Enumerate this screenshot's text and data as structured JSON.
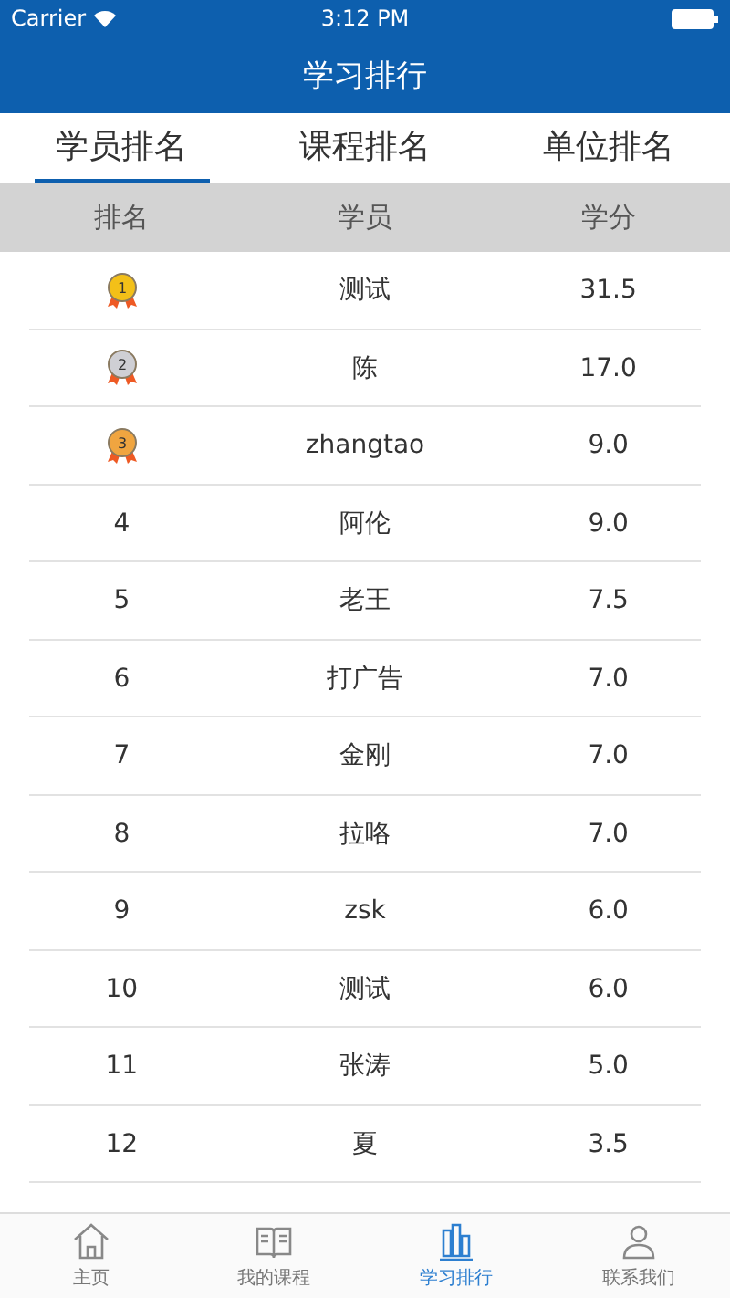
{
  "status_bar": {
    "carrier": "Carrier",
    "time": "3:12 PM"
  },
  "nav_bar": {
    "title": "学习排行"
  },
  "tabs": [
    {
      "label": "学员排名",
      "selected": true
    },
    {
      "label": "课程排名",
      "selected": false
    },
    {
      "label": "单位排名",
      "selected": false
    }
  ],
  "table": {
    "columns": [
      "排名",
      "学员",
      "学分"
    ],
    "rows": [
      {
        "kind": "medal",
        "color": "#f3c018",
        "rank": "1",
        "name": "测试",
        "credits": "31.5"
      },
      {
        "kind": "medal",
        "color": "#cfcfd4",
        "rank": "2",
        "name": "陈",
        "credits": "17.0"
      },
      {
        "kind": "medal",
        "color": "#f0a540",
        "rank": "3",
        "name": "zhangtao",
        "credits": "9.0"
      },
      {
        "kind": "plain",
        "rank": "4",
        "name": "阿伦",
        "credits": "9.0"
      },
      {
        "kind": "plain",
        "rank": "5",
        "name": "老王",
        "credits": "7.5"
      },
      {
        "kind": "plain",
        "rank": "6",
        "name": "打广告",
        "credits": "7.0"
      },
      {
        "kind": "plain",
        "rank": "7",
        "name": "金刚",
        "credits": "7.0"
      },
      {
        "kind": "plain",
        "rank": "8",
        "name": "拉咯",
        "credits": "7.0"
      },
      {
        "kind": "plain",
        "rank": "9",
        "name": "zsk",
        "credits": "6.0"
      },
      {
        "kind": "plain",
        "rank": "10",
        "name": "测试",
        "credits": "6.0"
      },
      {
        "kind": "plain",
        "rank": "11",
        "name": "张涛",
        "credits": "5.0"
      },
      {
        "kind": "plain",
        "rank": "12",
        "name": "夏",
        "credits": "3.5"
      }
    ]
  },
  "tab_bar": [
    {
      "kind": "home",
      "label": "主页",
      "selected": false
    },
    {
      "kind": "book",
      "label": "我的课程",
      "selected": false
    },
    {
      "kind": "chart",
      "label": "学习排行",
      "selected": true
    },
    {
      "kind": "contact",
      "label": "联系我们",
      "selected": false
    }
  ]
}
